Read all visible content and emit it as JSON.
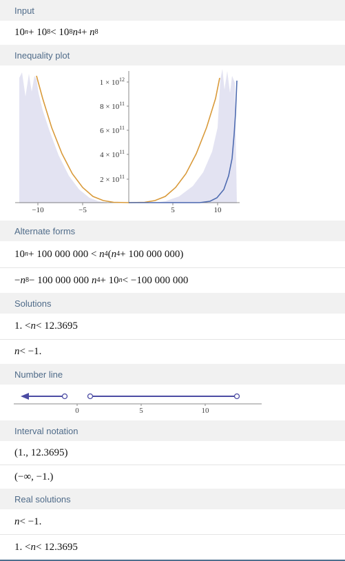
{
  "sections": {
    "input": "Input",
    "inequality_plot": "Inequality plot",
    "alternate_forms": "Alternate forms",
    "solutions": "Solutions",
    "number_line": "Number line",
    "interval_notation": "Interval notation",
    "real_solutions": "Real solutions"
  },
  "input": {
    "b1": "10",
    "e1": "n",
    "t1": " + 10",
    "e2": "8",
    "t2": " < 10",
    "e3": "8",
    "t3": " n",
    "e4": "4",
    "t4": " + n",
    "e5": "8"
  },
  "alt1": {
    "b": "10",
    "e1": "n",
    "t1": " + 100 000 000 < n",
    "e2": "4",
    "t2": " (n",
    "e3": "4",
    "t3": " + 100 000 000)"
  },
  "alt2": {
    "a": "−n",
    "e1": "8",
    "t1": " − 100 000 000 n",
    "e2": "4",
    "t2": " + 10",
    "e3": "n",
    "t3": " < −100 000 000"
  },
  "solutions": [
    "1. < n < 12.3695",
    "n < −1."
  ],
  "interval_notation": [
    "(1., 12.3695)",
    "(−∞, −1.)"
  ],
  "real_solutions": [
    "n < −1.",
    "1. < n < 12.3695"
  ],
  "plot": {
    "y_ticks": [
      {
        "m": "1 × 10",
        "e": "12"
      },
      {
        "m": "8 × 10",
        "e": "11"
      },
      {
        "m": "6 × 10",
        "e": "11"
      },
      {
        "m": "4 × 10",
        "e": "11"
      },
      {
        "m": "2 × 10",
        "e": "11"
      }
    ],
    "x_ticks": [
      "−10",
      "−5",
      "5",
      "10"
    ]
  },
  "number_line": {
    "ticks": [
      "0",
      "5",
      "10"
    ]
  },
  "colors": {
    "header_bg": "#f1f1f1",
    "header_text": "#4f6b89",
    "orange": "#d99a3a",
    "blue": "#4e6bb0",
    "fill": "#e3e3f2",
    "numline": "#4b4ba3"
  }
}
